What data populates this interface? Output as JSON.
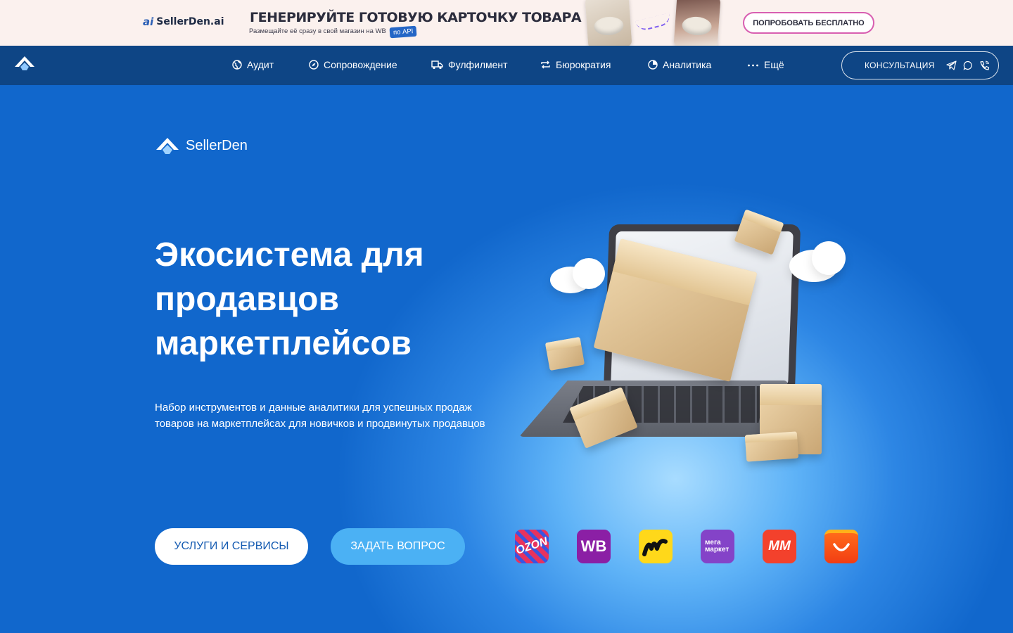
{
  "banner": {
    "logo_text": "SellerDen.ai",
    "logo_mark": "ai",
    "title": "ГЕНЕРИРУЙТЕ ГОТОВУЮ КАРТОЧКУ ТОВАРА",
    "subtitle": "Размещайте её сразу в свой магазин на WB",
    "api_badge": "по API",
    "cta_label": "ПОПРОБОВАТЬ БЕСПЛАТНО"
  },
  "nav": {
    "logo_icon": "home-roof-logo-icon",
    "items": [
      {
        "label": "Аудит",
        "icon": "globe-icon"
      },
      {
        "label": "Сопровождение",
        "icon": "compass-icon"
      },
      {
        "label": "Фулфилмент",
        "icon": "truck-icon"
      },
      {
        "label": "Бюрократия",
        "icon": "repeat-icon"
      },
      {
        "label": "Аналитика",
        "icon": "pie-chart-icon"
      },
      {
        "label": "Ещё",
        "icon": "more-dots-icon"
      }
    ],
    "consult_label": "КОНСУЛЬТАЦИЯ",
    "consult_icons": [
      "telegram-icon",
      "whatsapp-icon",
      "phone-icon"
    ]
  },
  "hero": {
    "brand": "SellerDen",
    "headline": "Экосистема для продавцов маркетплейсов",
    "subtext": "Набор инструментов и данные аналитики для успешных продаж товаров на маркетплейсах для новичков и продвинутых продавцов",
    "btn_services": "УСЛУГИ И СЕРВИСЫ",
    "btn_ask": "ЗАДАТЬ ВОПРОС",
    "marketplaces": [
      {
        "name": "ozon",
        "label": "OZON",
        "color": "#e8325e"
      },
      {
        "name": "wildberries",
        "label": "WB",
        "color": "#8b1fa5"
      },
      {
        "name": "yandex-market",
        "label": "M",
        "color": "#ffd81a"
      },
      {
        "name": "megamarket",
        "label": "мега маркет",
        "color": "#8443c8"
      },
      {
        "name": "magnit-market",
        "label": "MM",
        "color": "#f3412c"
      },
      {
        "name": "aliexpress",
        "label": "",
        "color": "#f23d13"
      }
    ],
    "colors": {
      "accent": "#4bb1f4",
      "nav_bg": "#0e4585",
      "hero_bg": "#1167cc"
    }
  }
}
